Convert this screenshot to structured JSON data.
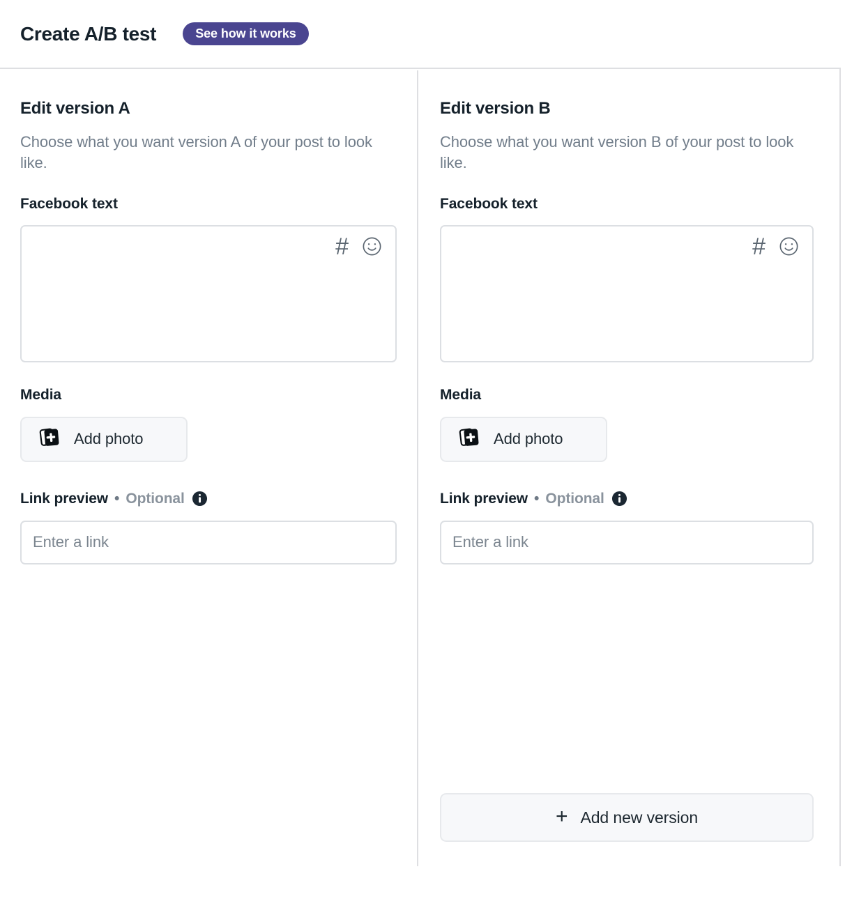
{
  "header": {
    "title": "Create A/B test",
    "badge_label": "See how it works",
    "badge_color": "#4a4590"
  },
  "colors": {
    "accent_purple": "#4a4590",
    "text_dark": "#15212b",
    "text_muted": "#717d8a",
    "border": "#dcdfe3",
    "surface_subtle": "#f7f8fa"
  },
  "columns": [
    {
      "title": "Edit version A",
      "subtitle": "Choose what you want version A of your post to look like.",
      "facebook_text_label": "Facebook text",
      "facebook_text_value": "",
      "facebook_text_placeholder": "",
      "hashtag_icon": "hashtag-icon",
      "emoji_icon": "emoji-smiley-icon",
      "media_label": "Media",
      "add_photo_label": "Add photo",
      "add_photo_icon": "photo-stack-plus-icon",
      "link_preview_label": "Link preview",
      "link_preview_separator": "•",
      "link_preview_optional": "Optional",
      "link_preview_info_icon": "info-circle-icon",
      "link_value": "",
      "link_placeholder": "Enter a link"
    },
    {
      "title": "Edit version B",
      "subtitle": "Choose what you want version B of your post to look like.",
      "facebook_text_label": "Facebook text",
      "facebook_text_value": "",
      "facebook_text_placeholder": "",
      "hashtag_icon": "hashtag-icon",
      "emoji_icon": "emoji-smiley-icon",
      "media_label": "Media",
      "add_photo_label": "Add photo",
      "add_photo_icon": "photo-stack-plus-icon",
      "link_preview_label": "Link preview",
      "link_preview_separator": "•",
      "link_preview_optional": "Optional",
      "link_preview_info_icon": "info-circle-icon",
      "link_value": "",
      "link_placeholder": "Enter a link"
    }
  ],
  "footer": {
    "add_version_label": "Add new version",
    "add_version_plus": "+"
  },
  "icons": {
    "hashtag_glyph": "#"
  }
}
